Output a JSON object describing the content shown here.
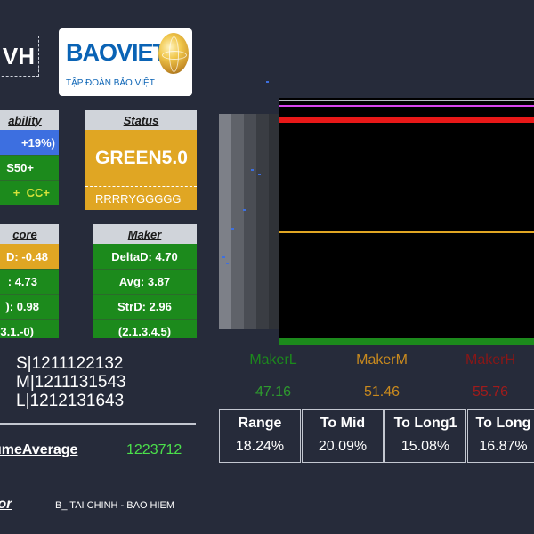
{
  "ticker": "VH",
  "logo": {
    "name": "BAOVIET",
    "subtitle": "TẬP ĐOÀN BẢO VIỆT"
  },
  "liquidity_card": {
    "title": "ability",
    "rows": [
      "+19%)",
      "S50+",
      "_+_CC+"
    ]
  },
  "status_card": {
    "title": "Status",
    "value": "GREEN5.0",
    "pattern": "RRRRYGGGGG"
  },
  "score_card": {
    "title": "core",
    "rows": [
      "D: -0.48",
      ": 4.73",
      "): 0.98",
      "3.1.-0)"
    ]
  },
  "maker_card": {
    "title": "Maker",
    "rows": [
      "DeltaD: 4.70",
      "Avg: 3.87",
      "StrD: 2.96",
      "(2.1.3.4.5)"
    ]
  },
  "makers": [
    {
      "label": "MakerL",
      "value": "47.16"
    },
    {
      "label": "MakerM",
      "value": "51.46"
    },
    {
      "label": "MakerH",
      "value": "55.76"
    }
  ],
  "metrics": [
    {
      "label": "Range",
      "value": "18.24%"
    },
    {
      "label": "To Mid",
      "value": "20.09%"
    },
    {
      "label": "To Long1",
      "value": "15.08%"
    },
    {
      "label": "To Long",
      "value": "16.87%"
    }
  ],
  "slm": {
    "s": "S|1211122132",
    "m": "M|1211131543",
    "l": "L|1212131643"
  },
  "volume": {
    "label": "umeAverage",
    "value": "1223712"
  },
  "sector": {
    "label": "tor",
    "value": "B_ TAI CHINH - BAO HIEM"
  },
  "colors": {
    "background": "#262b3a",
    "green": "#1c8a1c",
    "orange": "#e0a623",
    "blue": "#3d6fe0",
    "maker_low": "#2e9a2e",
    "maker_mid": "#c98a1e",
    "maker_high": "#a01b1b"
  }
}
